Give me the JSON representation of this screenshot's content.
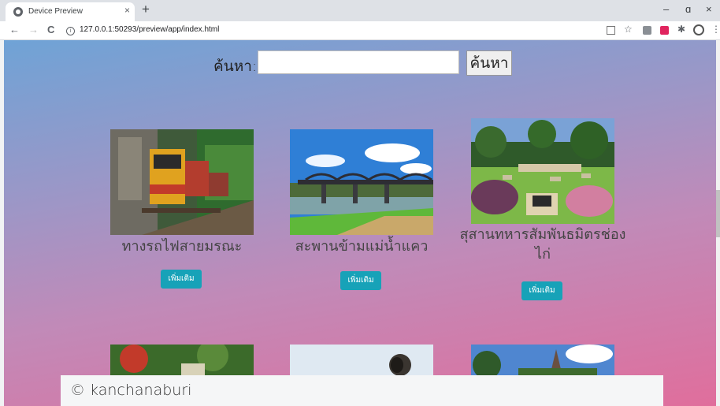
{
  "browser": {
    "tab_title": "Device Preview",
    "tab_close": "×",
    "new_tab": "+",
    "url": "127.0.0.1:50293/preview/app/index.html",
    "back": "←",
    "forward": "→",
    "reload": "C",
    "info": "i",
    "minimize": "–",
    "maximize": "ɑ",
    "close": "×",
    "star": "☆",
    "puzzle": "✱",
    "menu": "⋮"
  },
  "search": {
    "label": "ค้นหา:",
    "button": "ค้นหา",
    "value": ""
  },
  "places": [
    {
      "name": "ทางรถไฟสายมรณะ",
      "more": "เพิ่มเติม",
      "image": "death-railway-train-photo"
    },
    {
      "name": "สะพานข้ามแม่น้ำแคว",
      "more": "เพิ่มเติม",
      "image": "river-kwai-bridge-photo"
    },
    {
      "name": "สุสานทหารสัมพันธมิตรช่องไก่",
      "more": "เพิ่มเติม",
      "image": "allied-war-cemetery-photo"
    }
  ],
  "thumbnails": [
    "garden-photo",
    "cannon-photo",
    "temple-ruins-photo"
  ],
  "footer": {
    "text": "© kanchanaburi"
  },
  "colors": {
    "accent": "#17a2b8",
    "gradient_top": "#6fa3d6",
    "gradient_bottom": "#e06e9c"
  }
}
